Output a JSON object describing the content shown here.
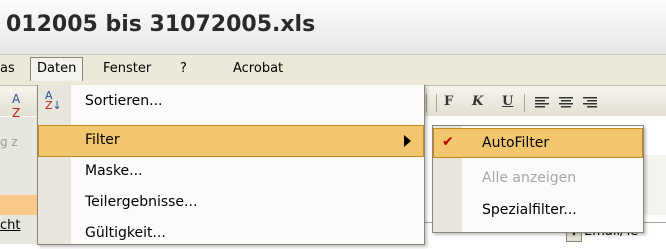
{
  "window": {
    "title": "012005 bis 31072005.xls"
  },
  "menubar": {
    "items": [
      "as",
      "Daten",
      "Fenster",
      "?",
      "Acrobat"
    ]
  },
  "toolbar": {
    "bold": "F",
    "italic": "K",
    "underline": "U"
  },
  "sheet": {
    "formula_peek": "g z",
    "cell_peek": "cht",
    "right_cell": "Email/Te"
  },
  "daten_menu": {
    "items": [
      {
        "label": "Sortieren...",
        "icon": "sort-ascending-icon"
      },
      {
        "label": "Filter",
        "has_submenu": true,
        "highlighted": true
      },
      {
        "label": "Maske..."
      },
      {
        "label": "Teilergebnisse..."
      },
      {
        "label": "Gültigkeit..."
      }
    ]
  },
  "filter_submenu": {
    "items": [
      {
        "label": "AutoFilter",
        "checked": true,
        "highlighted": true
      },
      {
        "label": "Alle anzeigen",
        "disabled": true
      },
      {
        "label": "Spezialfilter..."
      }
    ]
  },
  "colors": {
    "highlight": "#f2c66d",
    "highlight_border": "#c58a1f",
    "menu_bg": "#fbfbf9",
    "gutter": "#e7e5dc"
  }
}
